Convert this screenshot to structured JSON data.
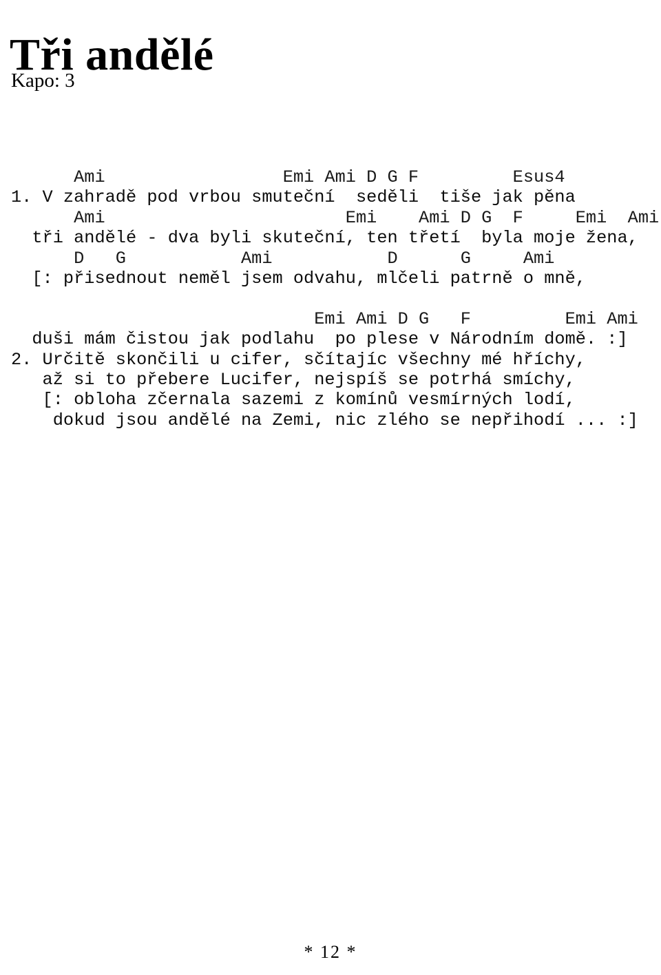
{
  "document": {
    "title": "Tři andělé",
    "capo_label": "Kapo: 3",
    "page_marker": "* 12 *",
    "language": "cs",
    "text_color": "#000000",
    "background_color": "#ffffff"
  },
  "song": {
    "lines": [
      {
        "kind": "chord",
        "text": "      Ami                 Emi Ami D G F         Esus4"
      },
      {
        "kind": "lyric",
        "text": "1. V zahradě pod vrbou smuteční  seděli  tiše jak pěna"
      },
      {
        "kind": "chord",
        "text": "      Ami                       Emi    Ami D G  F     Emi  Ami"
      },
      {
        "kind": "lyric",
        "text": "  tři andělé - dva byli skuteční, ten třetí  byla moje žena,"
      },
      {
        "kind": "chord",
        "text": "      D   G           Ami           D      G     Ami"
      },
      {
        "kind": "lyric",
        "text": "  [: přisednout neměl jsem odvahu, mlčeli patrně o mně,"
      },
      {
        "kind": "blank",
        "text": ""
      },
      {
        "kind": "chord",
        "text": "                             Emi Ami D G   F         Emi Ami"
      },
      {
        "kind": "lyric",
        "text": "  duši mám čistou jak podlahu  po plese v Národním domě. :]"
      },
      {
        "kind": "lyric",
        "text": "2. Určitě skončili u cifer, sčítajíc všechny mé hříchy,"
      },
      {
        "kind": "lyric",
        "text": "   až si to přebere Lucifer, nejspíš se potrhá smíchy,"
      },
      {
        "kind": "lyric",
        "text": "   [: obloha zčernala sazemi z komínů vesmírných lodí,"
      },
      {
        "kind": "lyric",
        "text": "    dokud jsou andělé na Zemi, nic zlého se nepřihodí ... :]"
      }
    ],
    "chords_used": [
      "Ami",
      "Emi",
      "D",
      "G",
      "F",
      "Esus4"
    ],
    "verse_numbers": [
      "1.",
      "2."
    ],
    "repeat_marks": [
      "[:",
      ":]"
    ]
  }
}
